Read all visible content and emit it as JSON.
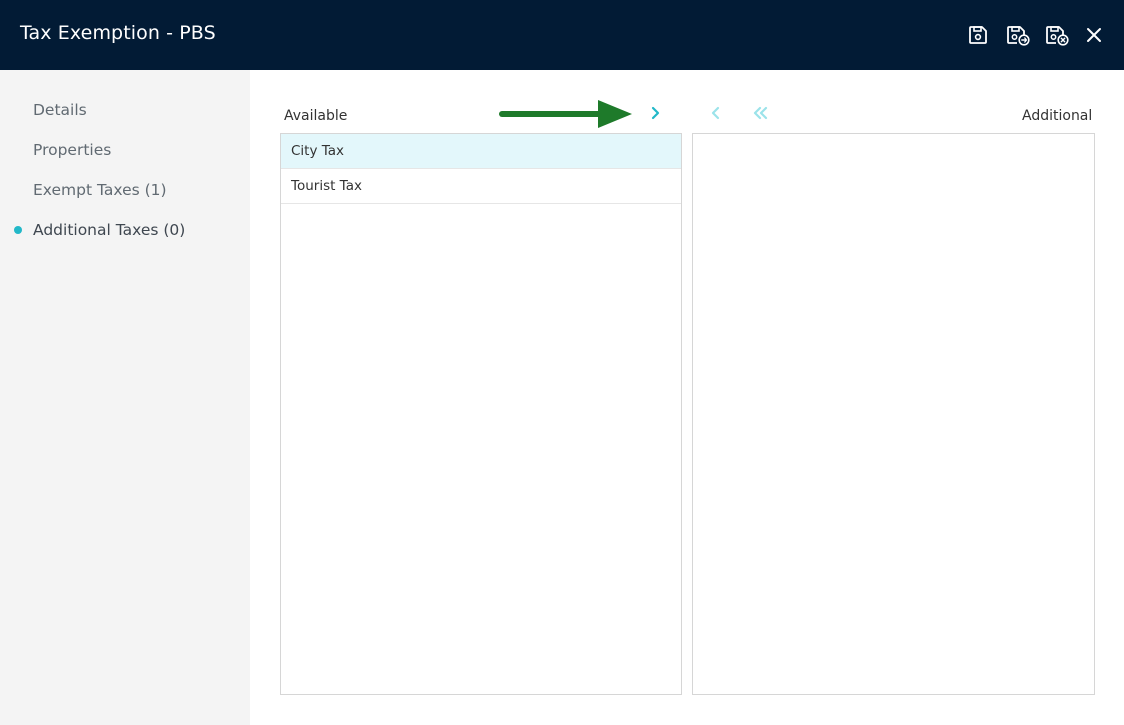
{
  "window": {
    "title": "Tax Exemption - PBS"
  },
  "header_actions": [
    {
      "icon": "save-icon",
      "label": "Save"
    },
    {
      "icon": "save-and-new-icon",
      "label": "Save and New"
    },
    {
      "icon": "save-and-close-icon",
      "label": "Save and Close"
    },
    {
      "icon": "close-icon",
      "label": "Close"
    }
  ],
  "sidebar": {
    "items": [
      {
        "label": "Details"
      },
      {
        "label": "Properties"
      },
      {
        "label": "Exempt Taxes (1)"
      },
      {
        "label": "Additional Taxes (0)",
        "active": true
      }
    ]
  },
  "dual_list": {
    "available_label": "Available",
    "additional_label": "Additional",
    "available_items": [
      {
        "label": "City Tax",
        "selected": true
      },
      {
        "label": "Tourist Tax",
        "selected": false
      }
    ],
    "additional_items": [],
    "controls": [
      {
        "icon": "chevron-right-icon",
        "label": "Move selected to Additional"
      },
      {
        "icon": "chevron-left-icon",
        "label": "Move selected to Available"
      },
      {
        "icon": "double-chevron-left-icon",
        "label": "Move all to Available"
      }
    ]
  },
  "colors": {
    "header_bg": "#021b35",
    "accent": "#22b8c8",
    "selected_row": "#e3f7fb",
    "annotation_arrow": "#1e7a2a"
  }
}
